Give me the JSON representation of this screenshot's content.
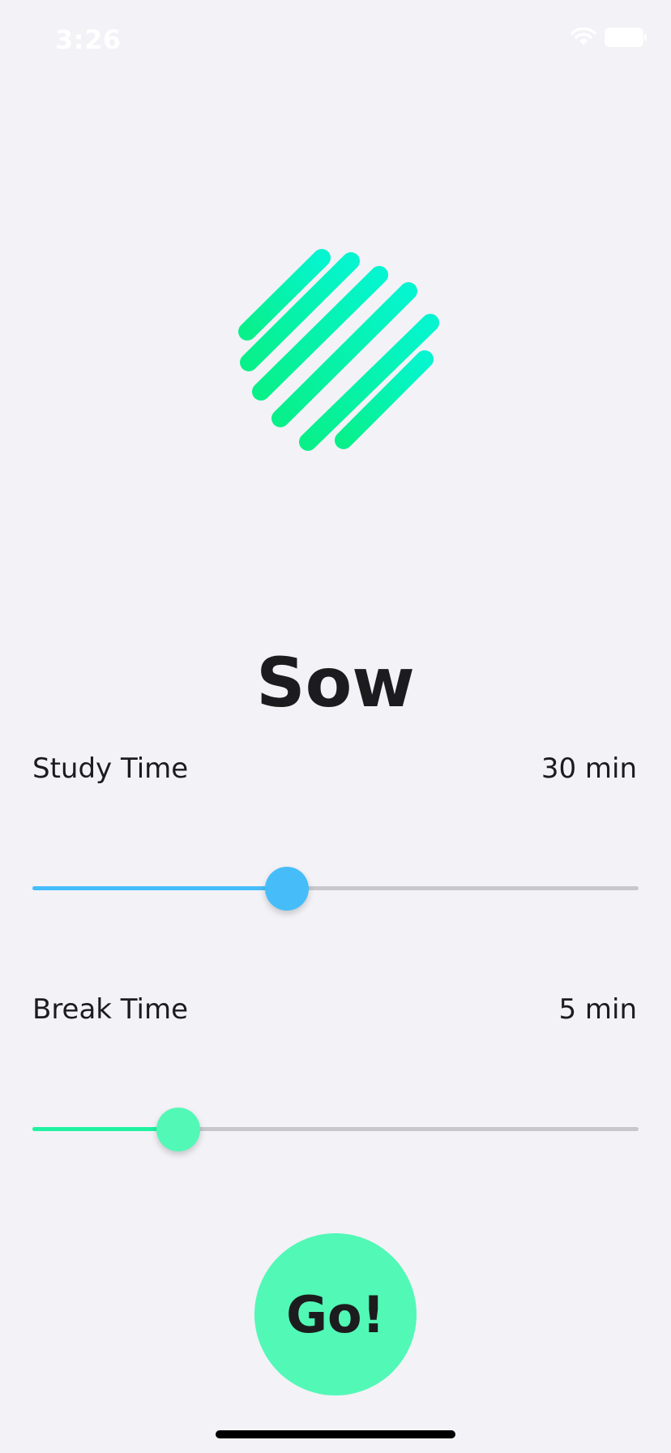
{
  "status_bar": {
    "time": "3:26"
  },
  "app": {
    "title": "Sow",
    "accent_green": "#52f8b6",
    "accent_blue": "#46bdf9",
    "logo_gradient": [
      "#05f0c2",
      "#0af590"
    ],
    "logo_icon": "sow-stripes-logo-icon"
  },
  "study": {
    "label": "Study Time",
    "value_label": "30 min",
    "slider_fraction": 0.42,
    "color": "#46bdf9"
  },
  "break": {
    "label": "Break Time",
    "value_label": "5 min",
    "slider_fraction": 0.24,
    "color": "#52f8b6",
    "fill_color": "#1ff2a0"
  },
  "go_button": {
    "label": "Go!"
  }
}
